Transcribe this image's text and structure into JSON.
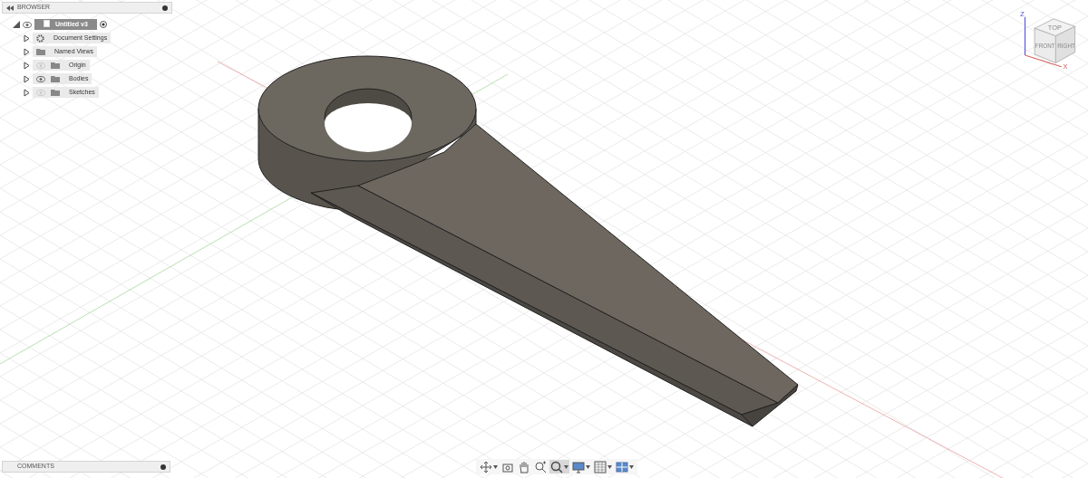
{
  "browser": {
    "title": "BROWSER",
    "root": {
      "label": "Untitled v3",
      "visible": true
    },
    "items": [
      {
        "label": "Document Settings",
        "kind": "settings"
      },
      {
        "label": "Named Views",
        "kind": "folder"
      },
      {
        "label": "Origin",
        "kind": "folder",
        "visible": false
      },
      {
        "label": "Bodies",
        "kind": "folder",
        "visible": true
      },
      {
        "label": "Sketches",
        "kind": "folder",
        "visible": false
      }
    ]
  },
  "viewcube": {
    "top": "TOP",
    "front": "FRONT",
    "right": "RIGHT",
    "z_axis": "Z",
    "x_axis": "X"
  },
  "toolbar": [
    {
      "kind": "orbit",
      "dropdown": true,
      "selected": false
    },
    {
      "kind": "look",
      "dropdown": false,
      "selected": false
    },
    {
      "kind": "pan",
      "dropdown": false,
      "selected": false
    },
    {
      "kind": "zoom",
      "dropdown": false,
      "selected": false
    },
    {
      "kind": "fit",
      "dropdown": true,
      "selected": true
    },
    {
      "kind": "display",
      "dropdown": true,
      "selected": false
    },
    {
      "kind": "grid",
      "dropdown": true,
      "selected": false
    },
    {
      "kind": "viewports",
      "dropdown": true,
      "selected": false
    }
  ],
  "comments": {
    "title": "COMMENTS"
  }
}
